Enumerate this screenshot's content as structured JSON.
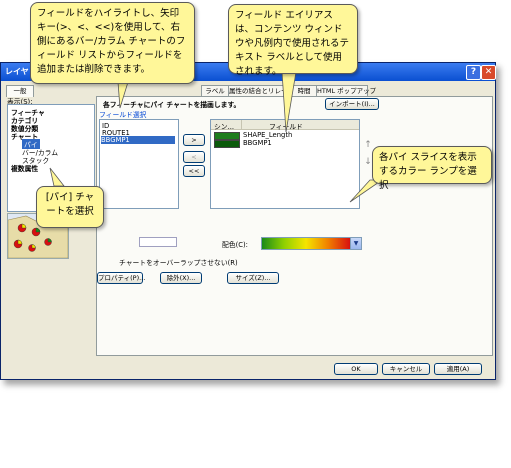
{
  "window": {
    "title": "レイヤ プロパティ",
    "help_glyph": "?",
    "close_glyph": "✕"
  },
  "tabs": [
    {
      "label": "一般"
    },
    {
      "label": "ラベル"
    },
    {
      "label": "属性の結合とリレート"
    },
    {
      "label": "時間"
    },
    {
      "label": "HTML ポップアップ"
    }
  ],
  "show_section": {
    "label": "表示(S):",
    "items": [
      "フィーチャ",
      "カテゴリ",
      "数値分類",
      "チャート",
      "パイ",
      "バー/カラム",
      "スタック",
      "複数属性"
    ]
  },
  "main": {
    "heading": "各フィーチャにパイ チャートを描画します。",
    "import_button": "インポート(I)...",
    "field_selection_label": "フィールド選択",
    "source_fields": [
      "ID",
      "ROUTE1",
      "BBGMP1"
    ],
    "columns": {
      "symbol": "シン...",
      "field": "フィールド"
    },
    "selected_fields": [
      {
        "name": "SHAPE_Length",
        "color": "#1e7d1e"
      },
      {
        "name": "BBGMP1",
        "color": "#0a5a0a"
      }
    ],
    "add_button": ">",
    "remove_button": "<",
    "remove_all_button": "<<",
    "up_arrow": "↑",
    "down_arrow": "↓",
    "color_scheme_label": "配色(C):",
    "overlap_label": "チャートをオーバーラップさせない(R)",
    "properties_button": "プロパティ(P)...",
    "exclude_button": "除外(X)...",
    "size_button": "サイズ(Z)...",
    "color_ramp_colors": [
      "#1a8a1a",
      "#8fd000",
      "#f5e400",
      "#f08000",
      "#d81010"
    ]
  },
  "footer": {
    "ok": "OK",
    "cancel": "キャンセル",
    "apply": "適用(A)"
  },
  "callouts": {
    "fields": "フィールドをハイライトし、矢印キー(>、<、<<)を使用して、右側にあるバー/カラム チャートのフィールド リストからフィールドを追加または削除できます。",
    "alias": "フィールド エイリアスは、コンテンツ ウィンドウや凡例内で使用されるテキスト ラベルとして使用されます。",
    "pie": "[パイ] チャートを選択",
    "ramp": "各パイ スライスを表示するカラー ランプを選択"
  }
}
